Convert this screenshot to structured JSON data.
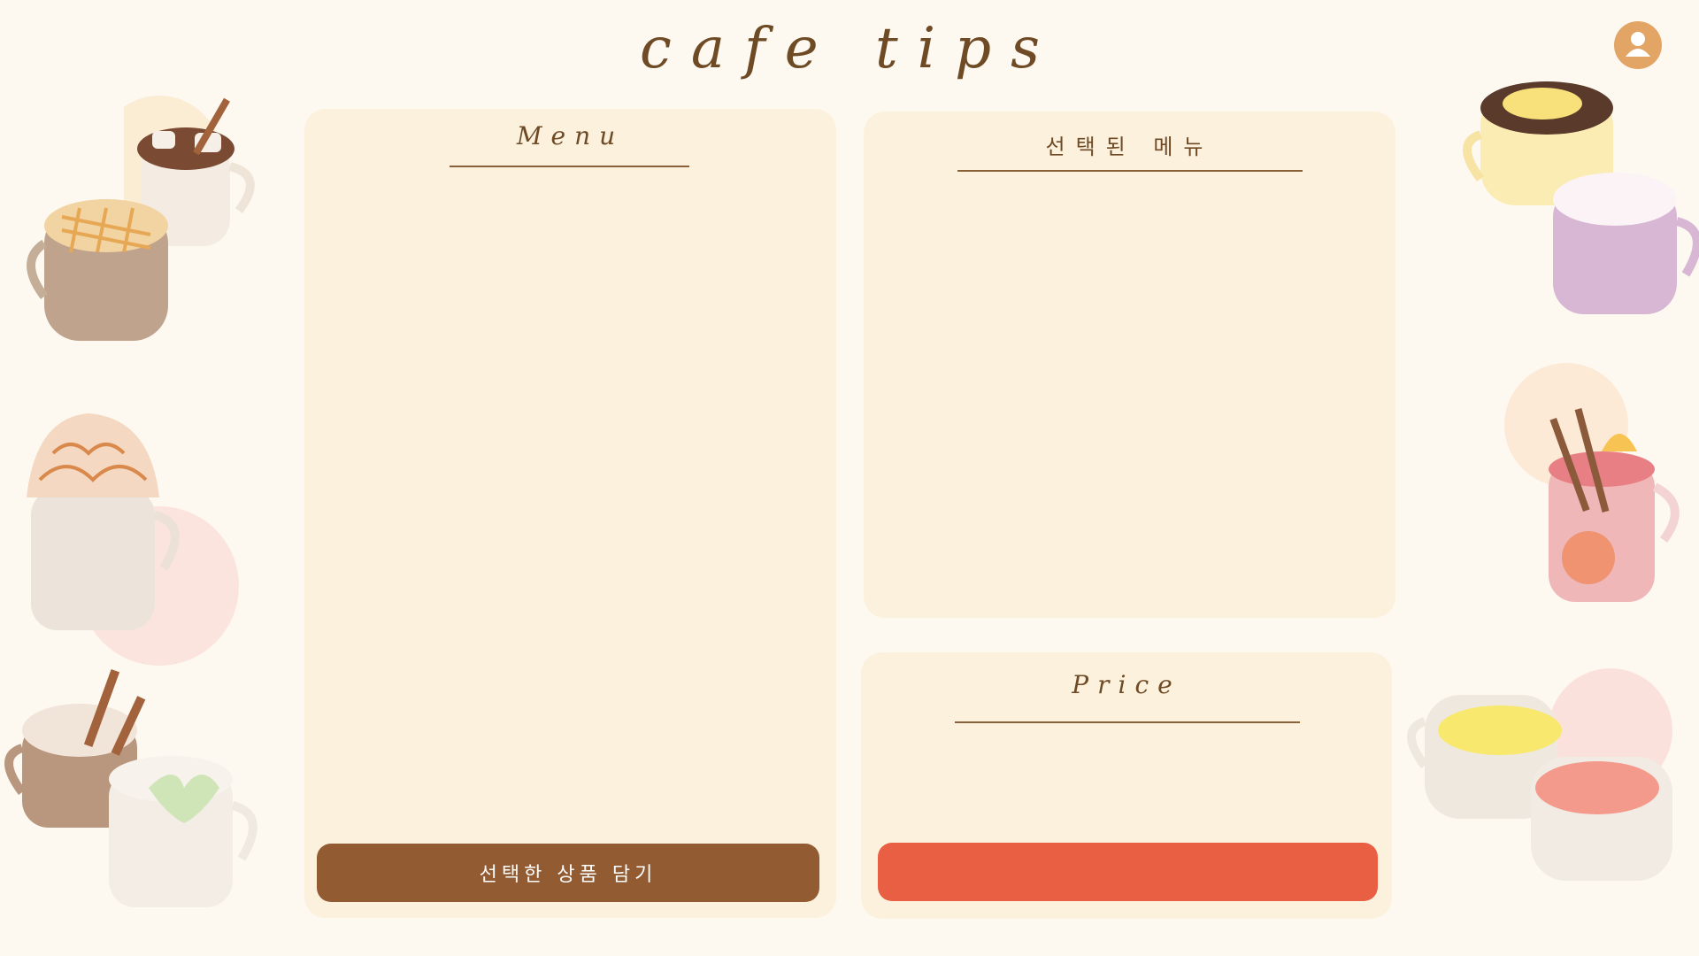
{
  "header": {
    "title": "cafe tips",
    "profile_icon": "user-icon"
  },
  "menu_panel": {
    "heading": "Menu",
    "add_button_label": "선택한 상품 담기"
  },
  "selected_panel": {
    "heading": "선택된 메뉴"
  },
  "price_panel": {
    "heading": "Price",
    "order_button_label": ""
  },
  "colors": {
    "background": "#fdf9f1",
    "panel": "#fcf1dd",
    "accent_brown": "#925b32",
    "accent_orange": "#e85f44",
    "profile": "#e3a565",
    "text": "#6e4a25"
  },
  "decorations": [
    "hot-chocolate-marshmallow-illustration",
    "waffle-latte-illustration",
    "whipped-cream-drink-illustration",
    "cinnamon-latte-illustration",
    "matcha-latte-illustration",
    "lemon-tea-illustration",
    "lavender-latte-illustration",
    "mulled-wine-illustration",
    "citrus-tea-illustration"
  ]
}
